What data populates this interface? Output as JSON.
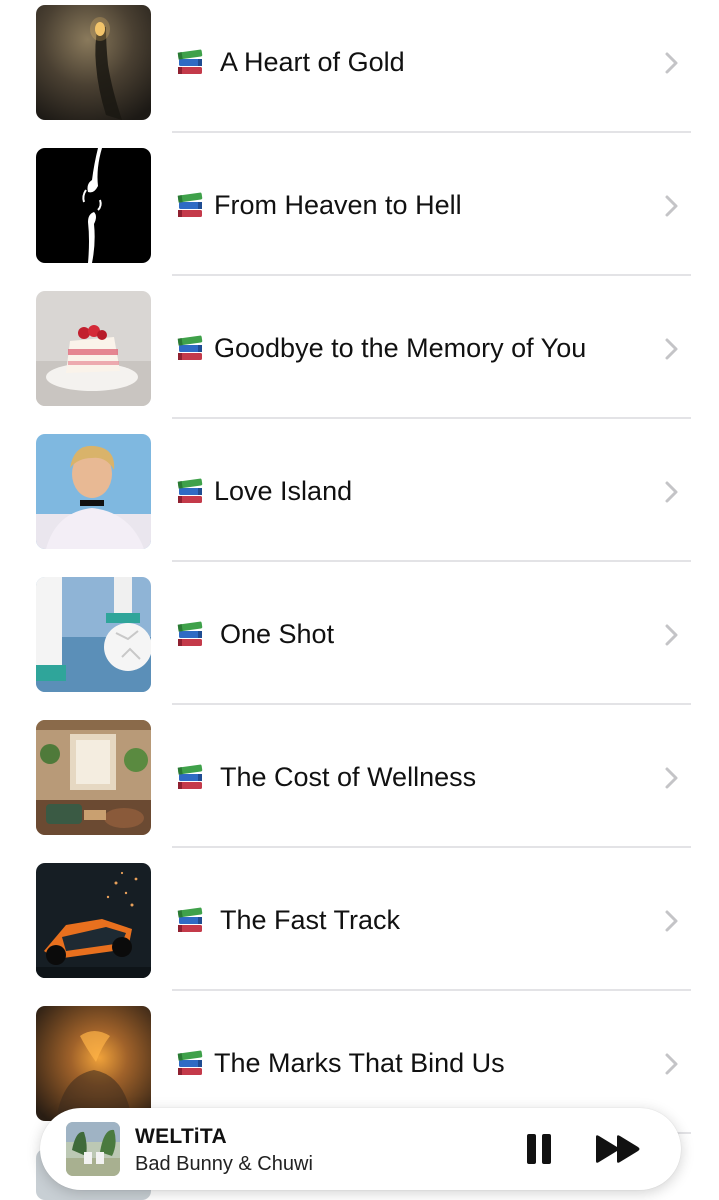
{
  "stories": [
    {
      "title": "A Heart of Gold",
      "icon": "books-icon"
    },
    {
      "title": "From Heaven to Hell",
      "icon": "books-icon"
    },
    {
      "title": "Goodbye to the Memory of You",
      "icon": "books-icon"
    },
    {
      "title": "Love Island",
      "icon": "books-icon"
    },
    {
      "title": "One Shot",
      "icon": "books-icon"
    },
    {
      "title": "The Cost of Wellness",
      "icon": "books-icon"
    },
    {
      "title": "The Fast Track",
      "icon": "books-icon"
    },
    {
      "title": "The Marks That Bind Us",
      "icon": "books-icon"
    }
  ],
  "now_playing": {
    "song": "WELTiTA",
    "artist": "Bad Bunny & Chuwi",
    "controls": [
      "pause-icon",
      "fast-forward-icon"
    ]
  },
  "colors": {
    "divider": "#e3e3e6",
    "chevron": "#c4c4c7",
    "text": "#111111",
    "background": "#ffffff"
  }
}
